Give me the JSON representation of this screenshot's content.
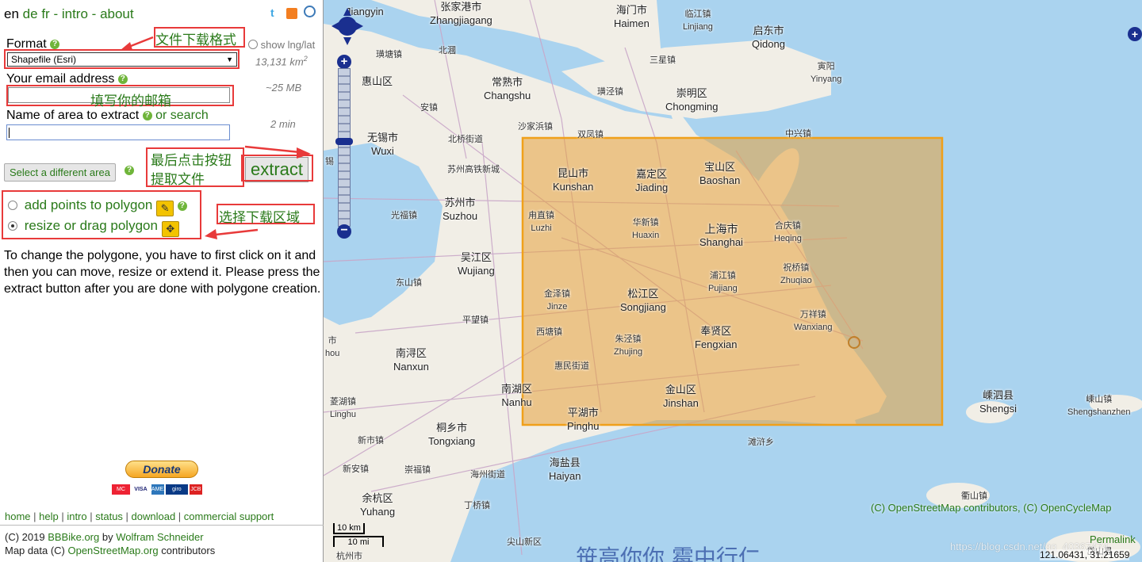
{
  "lang_bar": {
    "en": "en",
    "de": "de",
    "fr": "fr",
    "intro": "intro",
    "about": "about",
    "sep": "-"
  },
  "form": {
    "format_label": "Format",
    "format_value": "Shapefile (Esri)",
    "show_lnglat": "show lng/lat",
    "area_size": "13,131 km",
    "area_unit_sup": "2",
    "email_label": "Your email address",
    "file_size": "~25 MB",
    "name_label": "Name of area to extract",
    "or_search": "or search",
    "time_estimate": "2 min",
    "select_area_button": "Select a different area",
    "extract_button": "extract",
    "add_points": "add points to polygon",
    "resize_drag": "resize or drag polygon",
    "instructions": "To change the polygone, you have to first click on it and then you can move, resize or extend it. Please press the extract button after you are done with polygone creation."
  },
  "annotations": {
    "format_note": "文件下载格式",
    "email_note": "填写你的邮箱",
    "extract_note_1": "最后点击按钮",
    "extract_note_2": "提取文件",
    "area_note": "选择下载区域"
  },
  "donate": {
    "label": "Donate",
    "cards": [
      "MC",
      "VISA",
      "AMEX",
      "giro",
      "JCB"
    ]
  },
  "footer_links": [
    "home",
    "help",
    "intro",
    "status",
    "download",
    "commercial support"
  ],
  "credits": {
    "line1_prefix": "(C) 2019 ",
    "bbbike": "BBBike.org",
    "by": " by ",
    "author": "Wolfram Schneider",
    "line2_prefix": "Map data (C) ",
    "osm": "OpenStreetMap.org",
    "line2_suffix": " contributors"
  },
  "map": {
    "attribution": "(C) OpenStreetMap contributors, (C) OpenCycleMap",
    "permalink": "Permalink",
    "coords": "121.06431, 31.21659",
    "watermark": "https://blog.csdn.net/qq_40367474",
    "scale_km": "10 km",
    "scale_mi": "10 mi",
    "bottom_overlay": "笹高你你 霉中行仁",
    "colors": {
      "water": "#aad3ef",
      "land": "#f1eee6",
      "selection": "#e6a23c",
      "selection_border": "#f0a01a"
    },
    "labels": [
      {
        "zh": "张家港市",
        "en": "Zhangjiagang"
      },
      {
        "zh": "海门市",
        "en": "Haimen"
      },
      {
        "zh": "临江镇",
        "en": "Linjiang"
      },
      {
        "zh": "启东市",
        "en": "Qidong"
      },
      {
        "zh": "江阴",
        "en": "Jiangyin"
      },
      {
        "zh": "北漍",
        "en": ""
      },
      {
        "zh": "璜塘镇",
        "en": ""
      },
      {
        "zh": "三星镇",
        "en": ""
      },
      {
        "zh": "寅阳",
        "en": "Yinyang"
      },
      {
        "zh": "惠山区",
        "en": ""
      },
      {
        "zh": "常熟市",
        "en": "Changshu"
      },
      {
        "zh": "璜泾镇",
        "en": ""
      },
      {
        "zh": "崇明区",
        "en": "Chongming"
      },
      {
        "zh": "安镇",
        "en": ""
      },
      {
        "zh": "沙家浜镇",
        "en": ""
      },
      {
        "zh": "无锡市",
        "en": "Wuxi"
      },
      {
        "zh": "北桥街道",
        "en": ""
      },
      {
        "zh": "双凤镇",
        "en": ""
      },
      {
        "zh": "中兴镇",
        "en": ""
      },
      {
        "zh": "苏州高铁新城",
        "en": ""
      },
      {
        "zh": "昆山市",
        "en": "Kunshan"
      },
      {
        "zh": "嘉定区",
        "en": "Jiading"
      },
      {
        "zh": "宝山区",
        "en": "Baoshan"
      },
      {
        "zh": "苏州市",
        "en": "Suzhou"
      },
      {
        "zh": "光福镇",
        "en": ""
      },
      {
        "zh": "甪直镇",
        "en": "Luzhi"
      },
      {
        "zh": "华新镇",
        "en": "Huaxin"
      },
      {
        "zh": "上海市",
        "en": "Shanghai"
      },
      {
        "zh": "合庆镇",
        "en": "Heqing"
      },
      {
        "zh": "吴江区",
        "en": "Wujiang"
      },
      {
        "zh": "祝桥镇",
        "en": "Zhuqiao"
      },
      {
        "zh": "东山镇",
        "en": ""
      },
      {
        "zh": "浦江镇",
        "en": "Pujiang"
      },
      {
        "zh": "金泽镇",
        "en": "Jinze"
      },
      {
        "zh": "松江区",
        "en": "Songjiang"
      },
      {
        "zh": "万祥镇",
        "en": "Wanxiang"
      },
      {
        "zh": "平望镇",
        "en": ""
      },
      {
        "zh": "西塘镇",
        "en": ""
      },
      {
        "zh": "朱泾镇",
        "en": "Zhujing"
      },
      {
        "zh": "奉贤区",
        "en": "Fengxian"
      },
      {
        "zh": "南浔区",
        "en": "Nanxun"
      },
      {
        "zh": "惠民街道",
        "en": ""
      },
      {
        "zh": "嵊泗县",
        "en": "Shengsi"
      },
      {
        "zh": "嵊山镇",
        "en": "Shengshanzhen"
      },
      {
        "zh": "南湖区",
        "en": "Nanhu"
      },
      {
        "zh": "金山区",
        "en": "Jinshan"
      },
      {
        "zh": "菱湖镇",
        "en": "Linghu"
      },
      {
        "zh": "平湖市",
        "en": "Pinghu"
      },
      {
        "zh": "滩浒乡",
        "en": ""
      },
      {
        "zh": "新市镇",
        "en": ""
      },
      {
        "zh": "桐乡市",
        "en": "Tongxiang"
      },
      {
        "zh": "新安镇",
        "en": ""
      },
      {
        "zh": "崇福镇",
        "en": ""
      },
      {
        "zh": "海州街道",
        "en": ""
      },
      {
        "zh": "海盐县",
        "en": "Haiyan"
      },
      {
        "zh": "余杭区",
        "en": "Yuhang"
      },
      {
        "zh": "丁桥镇",
        "en": ""
      },
      {
        "zh": "衢山镇",
        "en": ""
      },
      {
        "zh": "尖山新区",
        "en": ""
      },
      {
        "zh": "杭州市",
        "en": ""
      },
      {
        "zh": "岱山县",
        "en": ""
      },
      {
        "zh": "锡",
        "en": ""
      },
      {
        "zh": "市",
        "en": "hou"
      }
    ]
  }
}
